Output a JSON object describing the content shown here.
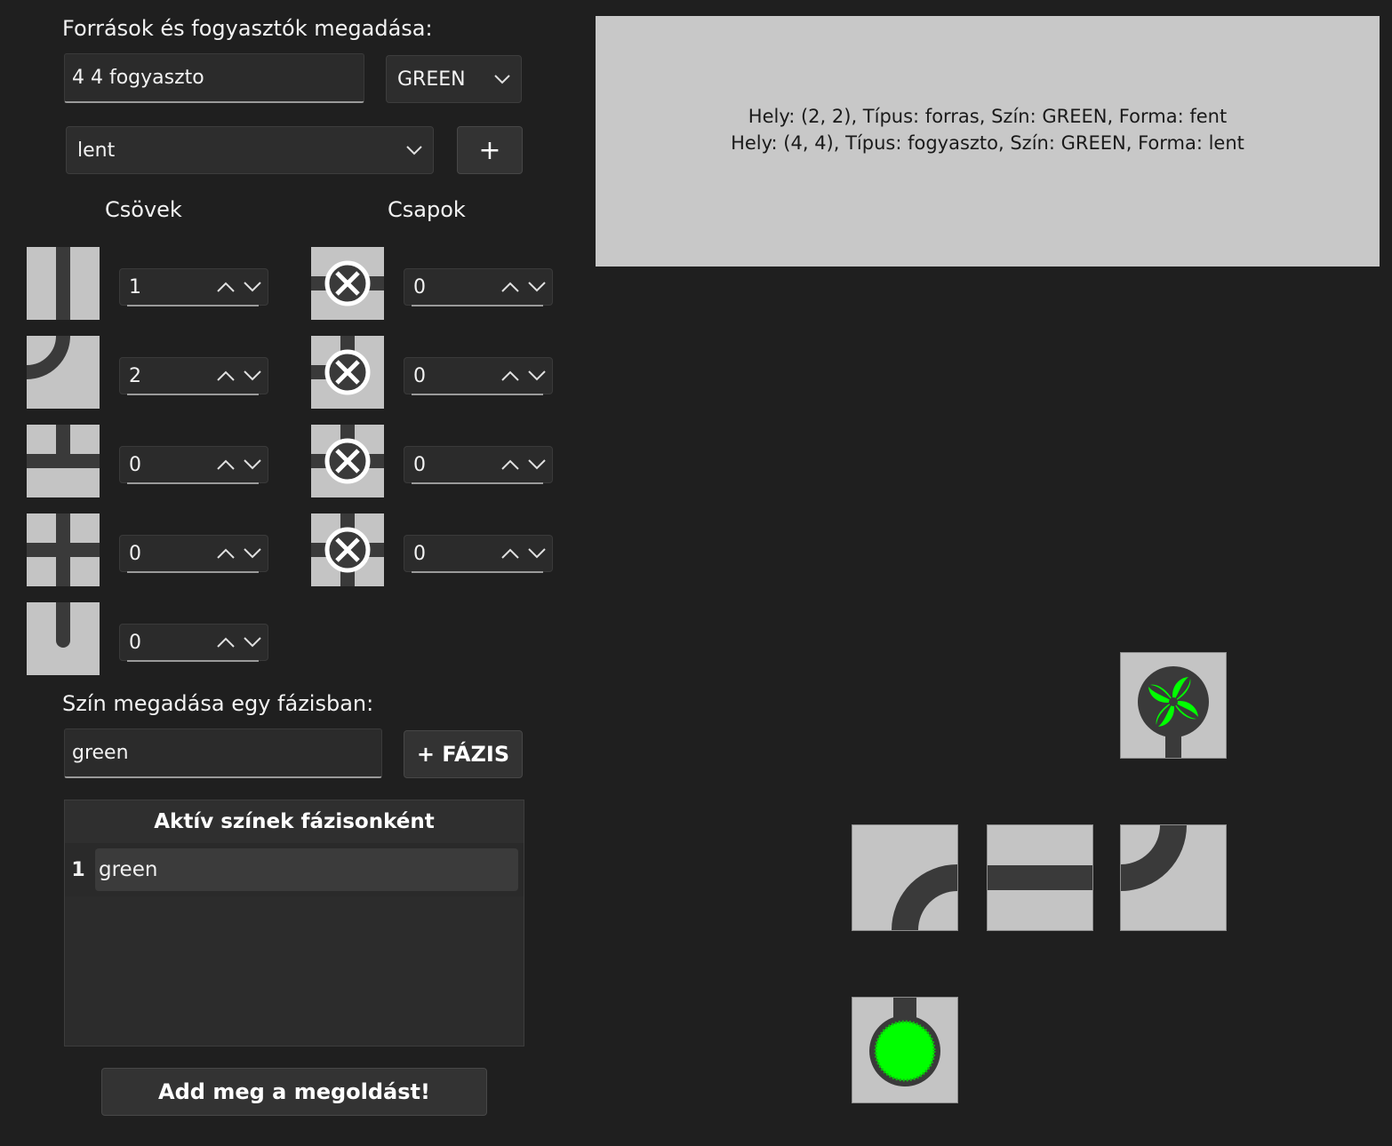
{
  "sources": {
    "heading": "Források és fogyasztók megadása:",
    "input_value": "4 4 fogyaszto",
    "color_select": "GREEN",
    "shape_select": "lent",
    "add_label": "+"
  },
  "columns": {
    "pipes_title": "Csövek",
    "taps_title": "Csapok"
  },
  "pipes": [
    {
      "icon": "straight-vertical-pipe-icon",
      "count": "1"
    },
    {
      "icon": "curved-pipe-icon",
      "count": "2"
    },
    {
      "icon": "t-junction-pipe-icon",
      "count": "0"
    },
    {
      "icon": "cross-pipe-icon",
      "count": "0"
    },
    {
      "icon": "end-cap-pipe-icon",
      "count": "0"
    }
  ],
  "taps": [
    {
      "icon": "horizontal-tap-icon",
      "count": "0"
    },
    {
      "icon": "top-left-tap-icon",
      "count": "0"
    },
    {
      "icon": "t-tap-icon",
      "count": "0"
    },
    {
      "icon": "cross-tap-icon",
      "count": "0"
    }
  ],
  "phase": {
    "heading": "Szín megadása egy fázisban:",
    "input_value": "green",
    "button_label": "+ FÁZIS"
  },
  "active_colors": {
    "header": "Aktív színek fázisonként",
    "rows": [
      {
        "index": "1",
        "color": "green"
      }
    ]
  },
  "submit_label": "Add meg a megoldást!",
  "info_lines": [
    "Hely: (2, 2), Típus: forras, Szín: GREEN, Forma: fent",
    "Hely: (4, 4), Típus: fogyaszto, Szín: GREEN, Forma: lent"
  ],
  "colors": {
    "background": "#1f1f1f",
    "tile": "#c4c4c4",
    "pipe": "#3a3a3a",
    "accent_green": "#00ff00"
  }
}
